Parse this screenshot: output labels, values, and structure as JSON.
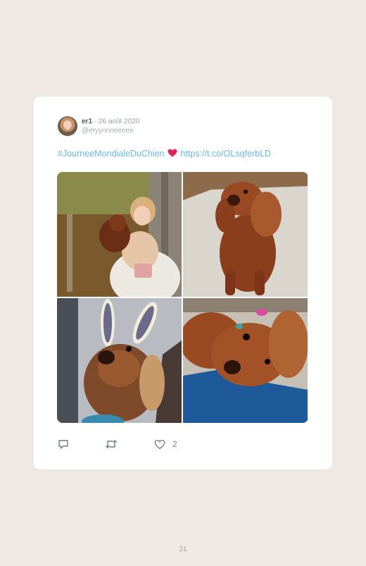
{
  "tweet": {
    "display_name": "er1",
    "separator": "·",
    "date": "26 août 2020",
    "handle": "@eryynnneeeee",
    "hashtag": "#JourneeMondialeDuChien",
    "emoji": "red-heart-emoji",
    "link": "https://t.co/OLsqferbLD",
    "photos": [
      {
        "icon": "photo-woman-holding-dog"
      },
      {
        "icon": "photo-dog-on-rug"
      },
      {
        "icon": "photo-dog-bunny-ears"
      },
      {
        "icon": "photo-dog-on-blue-blanket"
      }
    ],
    "actions": {
      "reply_icon": "reply-icon",
      "retweet_icon": "retweet-icon",
      "like_icon": "like-icon",
      "like_count": "2"
    }
  },
  "page": {
    "number": "21"
  },
  "colors": {
    "background": "#f0e8e5",
    "card": "#ffffff",
    "link": "#6db8e8",
    "heart": "#e0245e"
  }
}
